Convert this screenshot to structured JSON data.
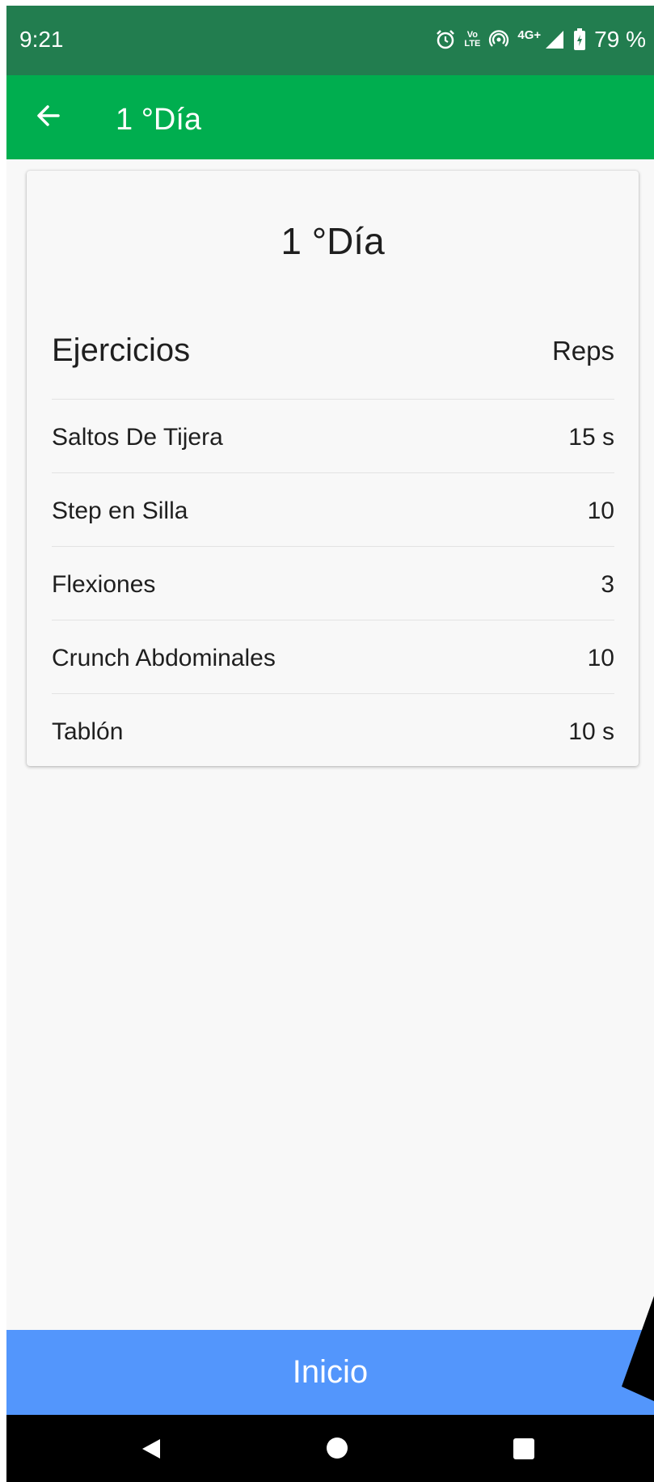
{
  "status_bar": {
    "time": "9:21",
    "network_label": "4G+",
    "lte_top": "Vo",
    "lte_bottom": "LTE",
    "battery": "79 %",
    "icons": [
      "alarm-icon",
      "volte-icon",
      "hotspot-icon",
      "signal-icon",
      "battery-icon"
    ]
  },
  "app_bar": {
    "title": "1 °Día",
    "back_icon": "arrow-left-icon"
  },
  "card": {
    "title": "1 °Día",
    "header": {
      "name": "Ejercicios",
      "reps": "Reps"
    },
    "rows": [
      {
        "name": "Saltos De Tijera",
        "reps": "15 s"
      },
      {
        "name": "Step en Silla",
        "reps": "10"
      },
      {
        "name": "Flexiones",
        "reps": "3"
      },
      {
        "name": "Crunch Abdominales",
        "reps": "10"
      },
      {
        "name": "Tablón",
        "reps": "10 s"
      }
    ]
  },
  "bottom": {
    "button_label": "Inicio"
  },
  "colors": {
    "status_bar": "#227d4f",
    "app_bar": "#00ae4f",
    "button": "#5396fc",
    "background": "#f8f8f8"
  }
}
